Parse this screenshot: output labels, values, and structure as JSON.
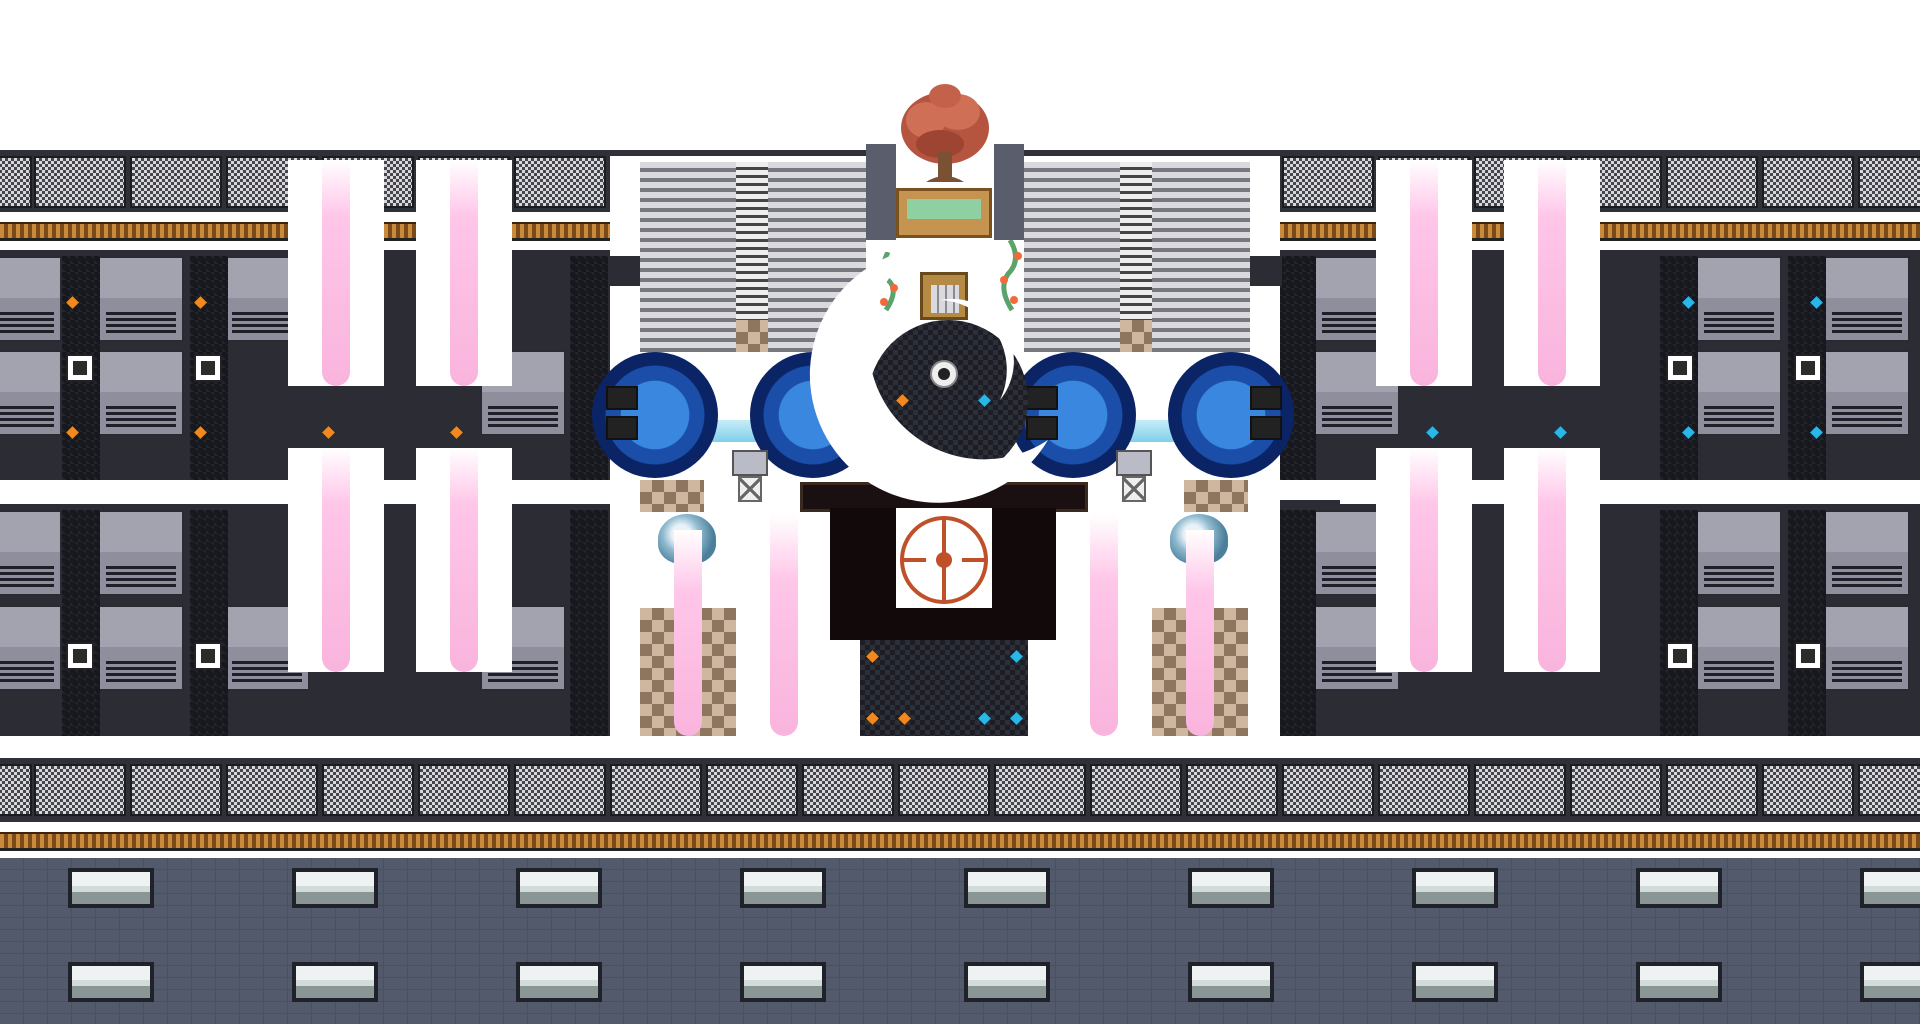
{
  "scene": {
    "name": "tech-lab-map",
    "view": "top-down",
    "palette": {
      "background": "#ffffff",
      "rail_dark": "#2f3038",
      "rack_gray": "#8e8e9c",
      "pink_light": "#f9b4dd",
      "wheel_blue": "#3a87e0",
      "orange_light": "#f08a20",
      "cyan_light": "#29b6e8",
      "building_wall": "#535a6c",
      "crescent": "#ffffff",
      "pod_dark": "#1d1e25",
      "tree_red": "#b5543f"
    },
    "icons": {
      "tree": "autumn-tree-icon",
      "crescent": "crescent-moon-icon",
      "elevator": "elevator-door-icon",
      "emblem": "target-emblem-icon",
      "eye": "eye-icon"
    }
  }
}
